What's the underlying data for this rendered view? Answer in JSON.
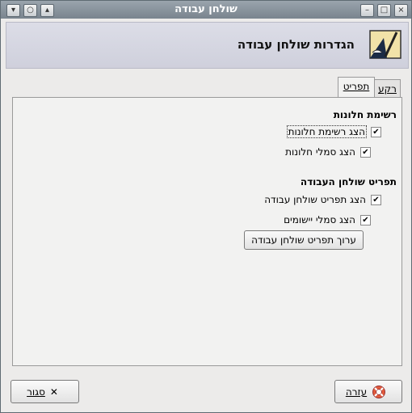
{
  "window": {
    "title": "שולחן עבודה",
    "buttons": [
      "chevron-down-icon",
      "restore-icon",
      "up-icon"
    ],
    "right_buttons": [
      "minimize-icon",
      "maximize-icon",
      "close-icon"
    ]
  },
  "header": {
    "title": "הגדרות שולחן עבודה",
    "icon": "desktop-settings-icon"
  },
  "tabs": [
    {
      "label": "רקע",
      "active": false
    },
    {
      "label": "תפריט",
      "active": true
    }
  ],
  "sections": {
    "window_list": {
      "title": "רשימת חלונות",
      "items": [
        {
          "label": "הצג רשימת חלונות",
          "checked": true
        },
        {
          "label": "הצג סמלי חלונות",
          "checked": true
        }
      ]
    },
    "desktop_menu": {
      "title": "תפריט שולחן העבודה",
      "items": [
        {
          "label": "הצג תפריט שולחן עבודה",
          "checked": true
        },
        {
          "label": "הצג סמלי יישומים",
          "checked": true
        }
      ],
      "edit_button": "ערוך תפריט שולחן עבודה"
    }
  },
  "footer": {
    "help_label": "עזרה",
    "close_label": "סגור",
    "check_mark": "✔"
  }
}
